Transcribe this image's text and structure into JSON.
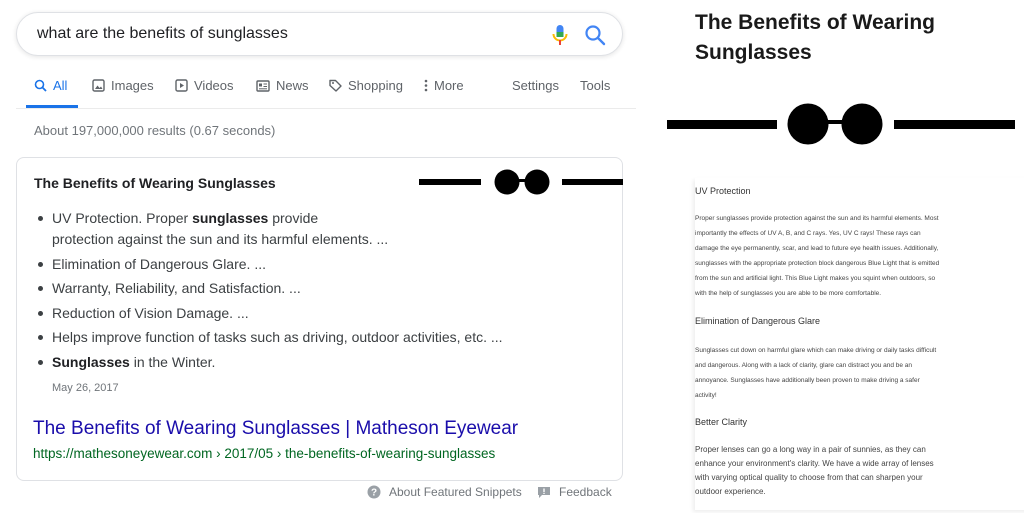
{
  "search": {
    "query": "what are the benefits of sunglasses"
  },
  "tabs": [
    {
      "label": "All",
      "icon": "search-icon",
      "active": true
    },
    {
      "label": "Images",
      "icon": "image-icon"
    },
    {
      "label": "Videos",
      "icon": "video-icon"
    },
    {
      "label": "News",
      "icon": "news-icon"
    },
    {
      "label": "Shopping",
      "icon": "tag-icon"
    },
    {
      "label": "More",
      "icon": "kebab-icon"
    },
    {
      "label": "Settings"
    },
    {
      "label": "Tools"
    }
  ],
  "results_stats": "About 197,000,000 results (0.67 seconds)",
  "snippet": {
    "title": "The Benefits of Wearing Sunglasses",
    "bullets": [
      {
        "pre": "UV Protection. Proper ",
        "bold": "sunglasses",
        "post": " provide",
        "cont": "protection against the sun and its harmful elements. ..."
      },
      {
        "pre": "Elimination of Dangerous Glare. ...",
        "bold": "",
        "post": ""
      },
      {
        "pre": "Warranty, Reliability, and Satisfaction. ...",
        "bold": "",
        "post": ""
      },
      {
        "pre": "Reduction of Vision Damage. ...",
        "bold": "",
        "post": ""
      },
      {
        "pre": "Helps improve function of tasks such as driving, outdoor activities, etc. ...",
        "bold": "",
        "post": ""
      },
      {
        "pre": "",
        "bold": "Sunglasses",
        "post": " in the Winter."
      }
    ],
    "date": "May 26, 2017",
    "result_title": "The Benefits of Wearing Sunglasses | Matheson Eyewear",
    "result_url": "https://mathesoneyewear.com › 2017/05 › the-benefits-of-wearing-sunglasses"
  },
  "footer": {
    "about": "About Featured Snippets",
    "feedback": "Feedback"
  },
  "article": {
    "title": "The Benefits of Wearing Sunglasses",
    "sections": [
      {
        "heading": "UV Protection",
        "lines": [
          "Proper sunglasses provide protection against the sun and its harmful elements. Most",
          "importantly the effects of UV A, B, and C rays. Yes, UV C rays! These rays can",
          "damage the eye permanently, scar, and lead to future eye health issues. Additionally,",
          "sunglasses with the appropriate protection block dangerous Blue Light that is emitted",
          "from the sun and artificial light. This Blue Light makes you squint when outdoors, so",
          "with the help of sunglasses you are able to be more comfortable."
        ]
      },
      {
        "heading": "Elimination of Dangerous Glare",
        "lines": [
          "Sunglasses cut down on harmful glare which can make driving or daily tasks difficult",
          "and dangerous. Along with a lack of clarity, glare can distract you and be an",
          "annoyance. Sunglasses have additionally been proven to make driving a safer",
          "activity!"
        ]
      },
      {
        "heading": "Better Clarity",
        "lines": [
          "Proper lenses can go a long way in a pair of sunnies, as they can",
          "enhance your environment's clarity. We have a wide array of lenses",
          "with varying optical quality to choose from that can sharpen your",
          "outdoor experience."
        ]
      }
    ]
  }
}
